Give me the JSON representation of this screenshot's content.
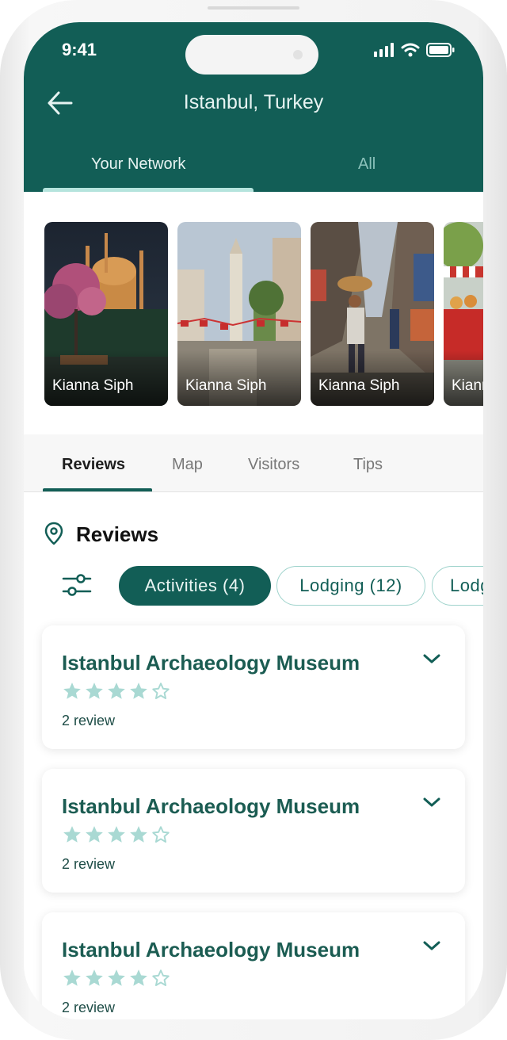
{
  "status_bar": {
    "time": "9:41"
  },
  "header": {
    "title": "Istanbul, Turkey",
    "tabs": [
      {
        "label": "Your Network",
        "active": true
      },
      {
        "label": "All",
        "active": false
      }
    ]
  },
  "stories": [
    {
      "name": "Kianna Siph",
      "scene": "mosque at night"
    },
    {
      "name": "Kianna Siph",
      "scene": "street with minaret"
    },
    {
      "name": "Kianna Siph",
      "scene": "bazaar street"
    },
    {
      "name": "Kianna Siph",
      "scene": "food cart"
    }
  ],
  "section_tabs": [
    {
      "label": "Reviews",
      "active": true
    },
    {
      "label": "Map",
      "active": false
    },
    {
      "label": "Visitors",
      "active": false
    },
    {
      "label": "Tips",
      "active": false
    }
  ],
  "reviews": {
    "heading": "Reviews",
    "filters": [
      {
        "label": "Activities (4)",
        "active": true
      },
      {
        "label": "Lodging (12)",
        "active": false
      },
      {
        "label": "Lodging",
        "active": false
      }
    ],
    "cards": [
      {
        "title": "Istanbul Archaeology Museum",
        "rating": 4,
        "count": "2 review"
      },
      {
        "title": "Istanbul Archaeology Museum",
        "rating": 4,
        "count": "2 review"
      },
      {
        "title": "Istanbul Archaeology Museum",
        "rating": 4,
        "count": "2 review"
      }
    ]
  },
  "colors": {
    "primary": "#125e56",
    "accent": "#b5e4dd",
    "star": "#a9d9d3"
  },
  "icons": [
    "back-arrow-icon",
    "signal-icon",
    "wifi-icon",
    "battery-icon",
    "location-pin-icon",
    "filter-sliders-icon",
    "chevron-down-icon",
    "star-icon"
  ]
}
